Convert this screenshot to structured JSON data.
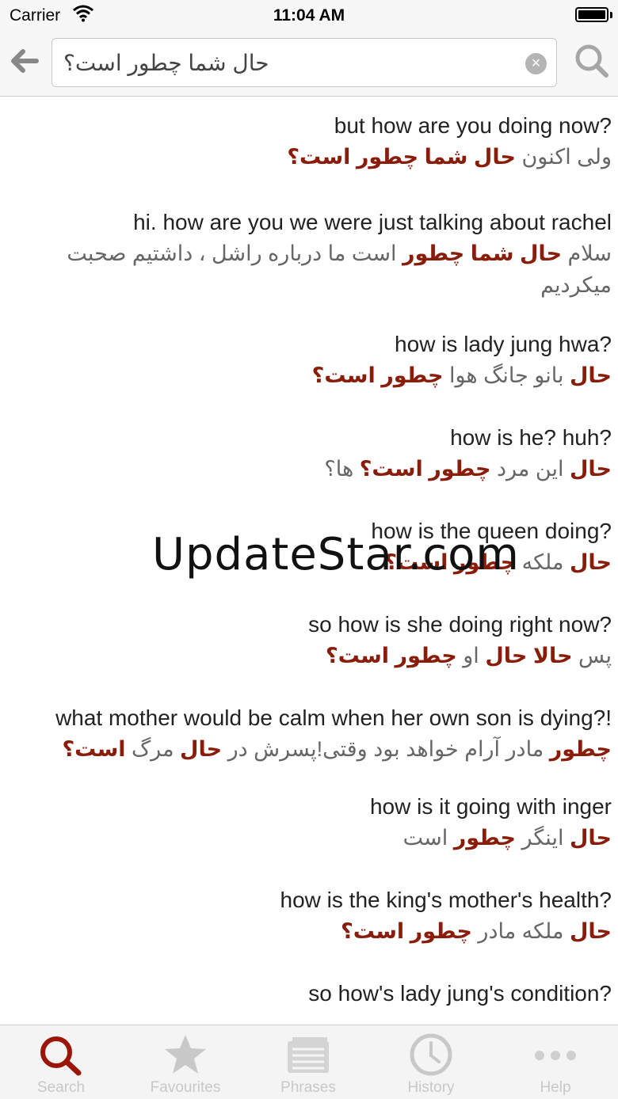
{
  "status": {
    "carrier": "Carrier",
    "time": "11:04 AM"
  },
  "search": {
    "query": "حال شما چطور است؟"
  },
  "results": [
    {
      "en": "but how are you doing now?",
      "fa": [
        [
          "ولی اکنون ",
          false
        ],
        [
          "حال شما چطور است؟",
          true
        ]
      ]
    },
    {
      "en": "hi. how are you we were just talking about rachel",
      "fa": [
        [
          "سلام ",
          false
        ],
        [
          "حال شما چطور",
          true
        ],
        [
          " است ما درباره راشل ، داشتیم صحبت میکردیم",
          false
        ]
      ]
    },
    {
      "en": "how is lady jung hwa?",
      "fa": [
        [
          "حال",
          true
        ],
        [
          " بانو جانگ هوا ",
          false
        ],
        [
          "چطور است؟",
          true
        ]
      ]
    },
    {
      "en": "how is he? huh?",
      "fa": [
        [
          "حال",
          true
        ],
        [
          " این مرد ",
          false
        ],
        [
          "چطور است؟",
          true
        ],
        [
          " ها؟",
          false
        ]
      ]
    },
    {
      "en": "how is the queen doing?",
      "fa": [
        [
          "حال",
          true
        ],
        [
          " ملکه ",
          false
        ],
        [
          "چطور است؟",
          true
        ]
      ]
    },
    {
      "en": "so how is she doing right now?",
      "fa": [
        [
          "پس ",
          false
        ],
        [
          "حالا حال",
          true
        ],
        [
          " او ",
          false
        ],
        [
          "چطور است؟",
          true
        ]
      ]
    },
    {
      "en": "what mother would be calm when her own son is dying?!",
      "fa": [
        [
          "چطور",
          true
        ],
        [
          " مادر آرام خواهد بود وقتی!پسرش در ",
          false
        ],
        [
          "حال",
          true
        ],
        [
          " مرگ ",
          false
        ],
        [
          "است؟",
          true
        ]
      ]
    },
    {
      "en": "how is it going with inger",
      "fa": [
        [
          "حال",
          true
        ],
        [
          " اینگر ",
          false
        ],
        [
          "چطور",
          true
        ],
        [
          " است",
          false
        ]
      ]
    },
    {
      "en": "how is the king's mother's health?",
      "fa": [
        [
          "حال",
          true
        ],
        [
          " ملکه مادر ",
          false
        ],
        [
          "چطور است؟",
          true
        ]
      ]
    },
    {
      "en": "so how's lady jung's condition?",
      "fa": []
    }
  ],
  "tabs": [
    {
      "label": "Search",
      "icon": "search-icon",
      "active": true
    },
    {
      "label": "Favourites",
      "icon": "star-icon",
      "active": false
    },
    {
      "label": "Phrases",
      "icon": "phrases-icon",
      "active": false
    },
    {
      "label": "History",
      "icon": "clock-icon",
      "active": false
    },
    {
      "label": "Help",
      "icon": "more-icon",
      "active": false
    }
  ],
  "watermark": "UpdateStar.com",
  "colors": {
    "highlight": "#8a1c0a",
    "active_tab": "#9b1608",
    "inactive_tab": "#c8c8c8"
  }
}
